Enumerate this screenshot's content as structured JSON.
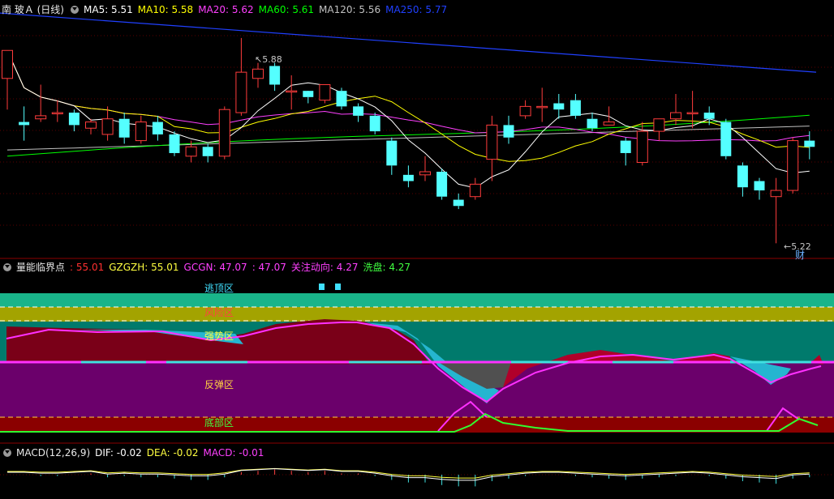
{
  "main_panel": {
    "title": "南 玻Ａ (日线)",
    "indicators": [
      {
        "label": "MA5: 5.51",
        "color": "#ffffff"
      },
      {
        "label": "MA10: 5.58",
        "color": "#ffff00"
      },
      {
        "label": "MA20: 5.62",
        "color": "#ff40ff"
      },
      {
        "label": "MA60: 5.61",
        "color": "#00ff00"
      },
      {
        "label": "MA120: 5.56",
        "color": "#c0c0c0"
      },
      {
        "label": "MA250: 5.77",
        "color": "#2040ff"
      }
    ],
    "high_marker": "5.88",
    "low_marker": "5.22",
    "event_badge": "财"
  },
  "energy_panel": {
    "title": "量能临界点",
    "values": [
      {
        "label": ": 55.01",
        "color": "#ff3030"
      },
      {
        "label": "GZGZH: 55.01",
        "color": "#ffff40"
      },
      {
        "label": "GCGN: 47.07",
        "color": "#ff40ff"
      },
      {
        "label": ": 47.07",
        "color": "#ff40ff"
      },
      {
        "label": "关注动向: 4.27",
        "color": "#ff40ff"
      },
      {
        "label": "洗盘: 4.27",
        "color": "#40ff40"
      }
    ],
    "zones": [
      {
        "label": "逃顶区",
        "color": "#40e0ff"
      },
      {
        "label": "风险区",
        "color": "#ff4040"
      },
      {
        "label": "强势区",
        "color": "#ffff40"
      },
      {
        "label": "反弹区",
        "color": "#ffd040"
      },
      {
        "label": "底部区",
        "color": "#40ff40"
      }
    ]
  },
  "macd_panel": {
    "title": "MACD(12,26,9)",
    "values": [
      {
        "label": "DIF: -0.02",
        "color": "#ffffff"
      },
      {
        "label": "DEA: -0.02",
        "color": "#ffff40"
      },
      {
        "label": "MACD: -0.01",
        "color": "#ff40ff"
      }
    ]
  },
  "chart_data": {
    "type": "candlestick",
    "series_colors": {
      "up": "#ff3c3c",
      "down": "#54ffff"
    },
    "candles": [
      [
        5.75,
        5.84,
        5.68,
        5.65
      ],
      [
        5.61,
        5.6,
        5.66,
        5.55
      ],
      [
        5.62,
        5.63,
        5.73,
        5.61
      ],
      [
        5.64,
        5.64,
        5.68,
        5.61
      ],
      [
        5.64,
        5.6,
        5.65,
        5.58
      ],
      [
        5.59,
        5.61,
        5.62,
        5.57
      ],
      [
        5.57,
        5.62,
        5.66,
        5.55
      ],
      [
        5.62,
        5.56,
        5.64,
        5.54
      ],
      [
        5.55,
        5.61,
        5.63,
        5.54
      ],
      [
        5.61,
        5.57,
        5.63,
        5.55
      ],
      [
        5.57,
        5.51,
        5.58,
        5.5
      ],
      [
        5.5,
        5.53,
        5.55,
        5.48
      ],
      [
        5.53,
        5.5,
        5.54,
        5.48
      ],
      [
        5.5,
        5.65,
        5.66,
        5.49
      ],
      [
        5.64,
        5.77,
        5.88,
        5.63
      ],
      [
        5.75,
        5.78,
        5.8,
        5.72
      ],
      [
        5.79,
        5.73,
        5.8,
        5.71
      ],
      [
        5.71,
        5.71,
        5.76,
        5.65
      ],
      [
        5.71,
        5.69,
        5.7,
        5.67
      ],
      [
        5.68,
        5.73,
        5.73,
        5.67
      ],
      [
        5.71,
        5.66,
        5.72,
        5.65
      ],
      [
        5.66,
        5.63,
        5.67,
        5.61
      ],
      [
        5.63,
        5.58,
        5.64,
        5.57
      ],
      [
        5.55,
        5.47,
        5.56,
        5.44
      ],
      [
        5.44,
        5.42,
        5.47,
        5.4
      ],
      [
        5.44,
        5.45,
        5.5,
        5.42
      ],
      [
        5.45,
        5.37,
        5.46,
        5.36
      ],
      [
        5.36,
        5.34,
        5.38,
        5.33
      ],
      [
        5.37,
        5.41,
        5.43,
        5.36
      ],
      [
        5.49,
        5.6,
        5.63,
        5.42
      ],
      [
        5.6,
        5.56,
        5.63,
        5.54
      ],
      [
        5.63,
        5.66,
        5.68,
        5.62
      ],
      [
        5.66,
        5.66,
        5.72,
        5.61
      ],
      [
        5.67,
        5.65,
        5.7,
        5.62
      ],
      [
        5.68,
        5.63,
        5.7,
        5.62
      ],
      [
        5.62,
        5.59,
        5.64,
        5.58
      ],
      [
        5.6,
        5.61,
        5.66,
        5.6
      ],
      [
        5.55,
        5.51,
        5.56,
        5.47
      ],
      [
        5.48,
        5.58,
        5.61,
        5.47
      ],
      [
        5.58,
        5.62,
        5.62,
        5.55
      ],
      [
        5.62,
        5.64,
        5.7,
        5.6
      ],
      [
        5.64,
        5.64,
        5.71,
        5.59
      ],
      [
        5.64,
        5.62,
        5.66,
        5.6
      ],
      [
        5.61,
        5.5,
        5.62,
        5.49
      ],
      [
        5.47,
        5.4,
        5.48,
        5.37
      ],
      [
        5.42,
        5.39,
        5.43,
        5.36
      ],
      [
        5.37,
        5.39,
        5.43,
        5.22
      ],
      [
        5.39,
        5.55,
        5.56,
        5.38
      ],
      [
        5.55,
        5.53,
        5.58,
        5.49
      ]
    ]
  }
}
